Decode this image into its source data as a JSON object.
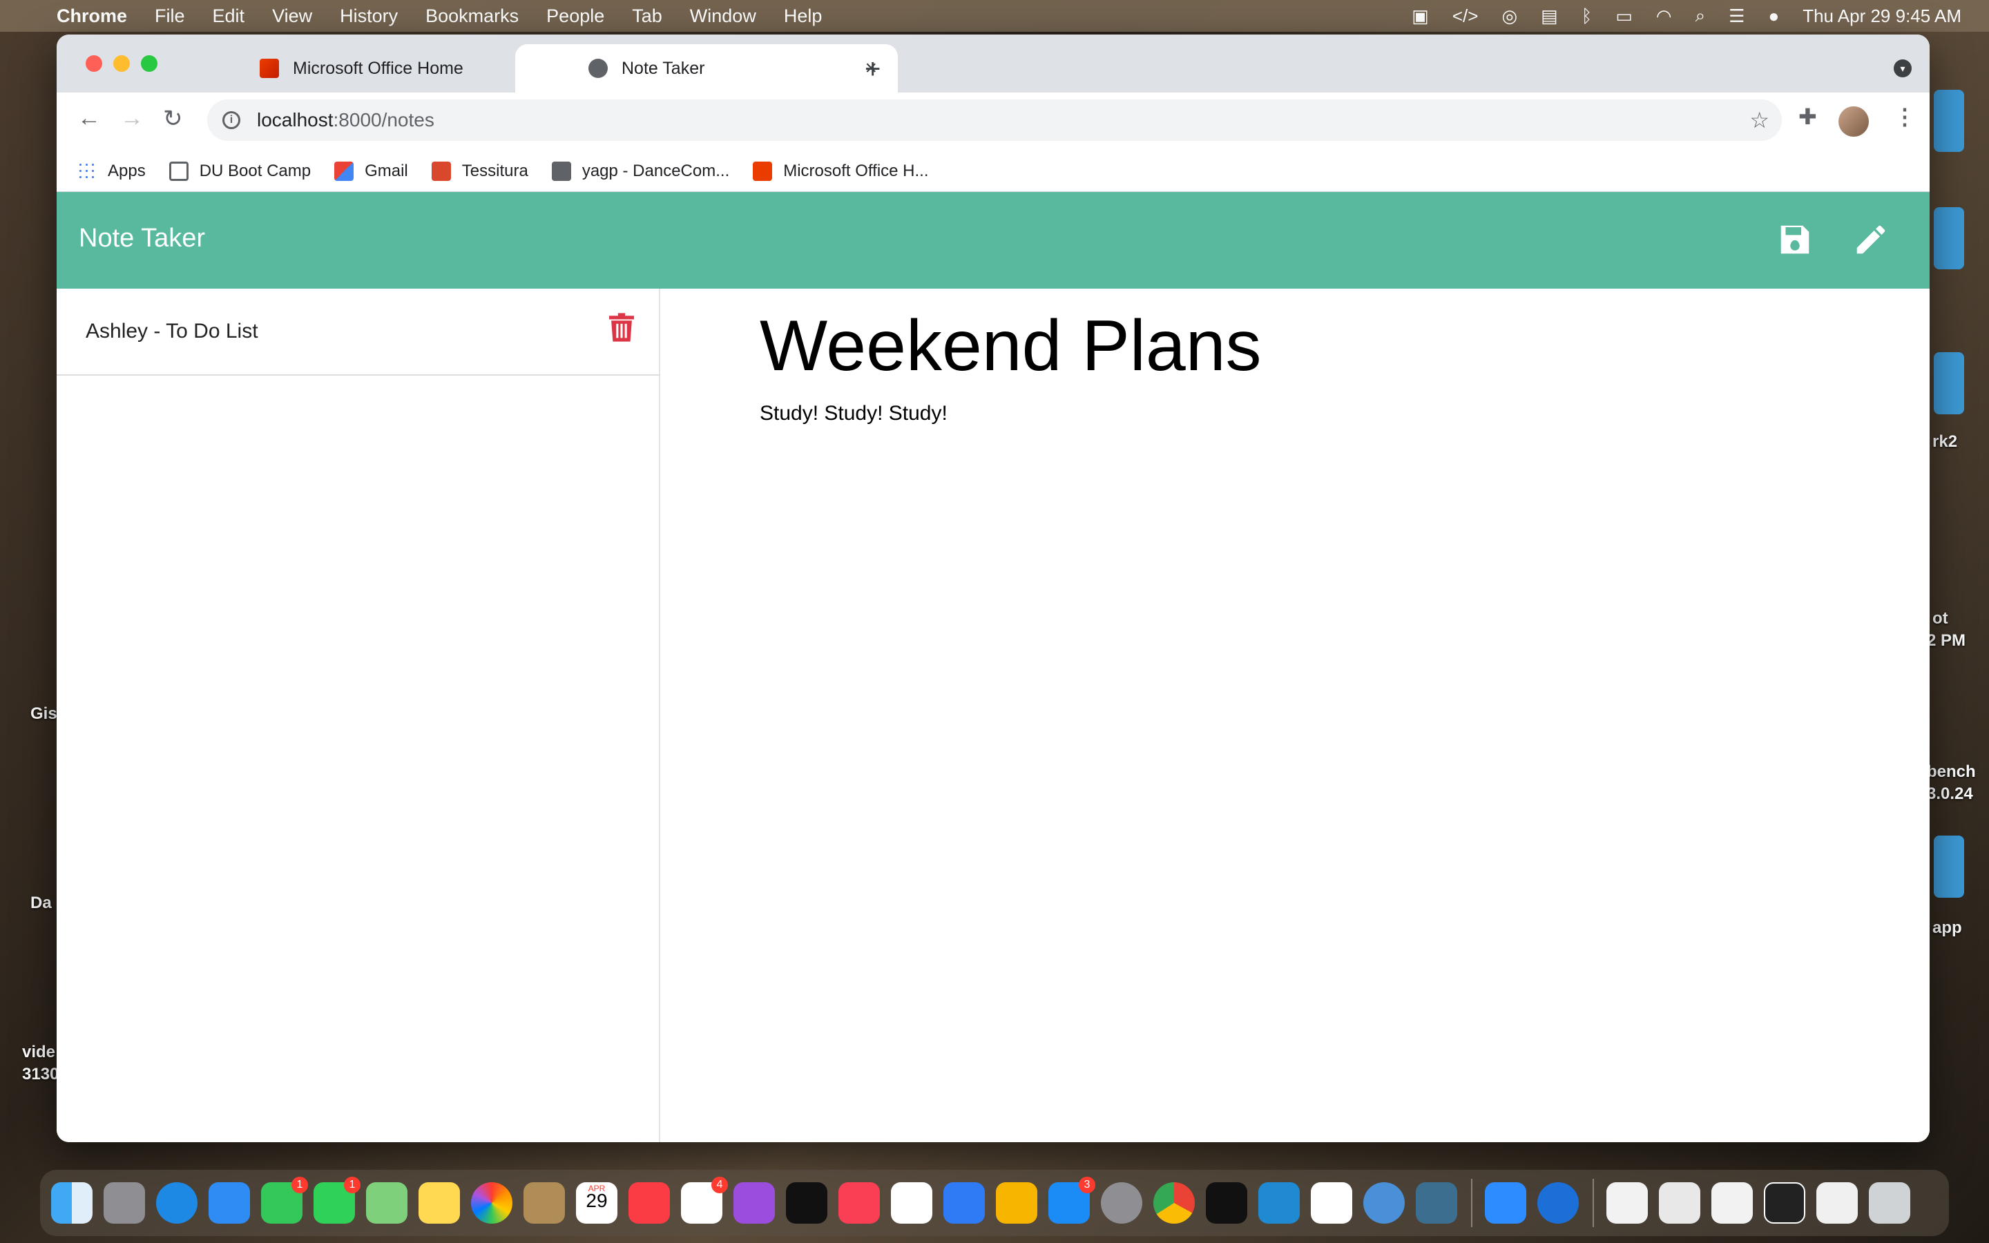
{
  "menubar": {
    "app_name": "Chrome",
    "items": [
      "File",
      "Edit",
      "View",
      "History",
      "Bookmarks",
      "People",
      "Tab",
      "Window",
      "Help"
    ],
    "datetime": "Thu Apr 29  9:45 AM"
  },
  "desktop_labels": {
    "left1": "Gis",
    "left2": "Da",
    "left3": "vide",
    "left3b": "3130",
    "right1": "rk2",
    "right2": "ot",
    "right3": "2 PM",
    "right4": "bench",
    "right5": "3.0.24",
    "right6": "app"
  },
  "browser": {
    "tabs": [
      {
        "title": "Microsoft Office Home",
        "active": false
      },
      {
        "title": "Note Taker",
        "active": true
      }
    ],
    "url_host": "localhost",
    "url_path": ":8000/notes",
    "bookmarks": [
      "Apps",
      "DU Boot Camp",
      "Gmail",
      "Tessitura",
      "yagp - DanceCom...",
      "Microsoft Office H..."
    ]
  },
  "app": {
    "title": "Note Taker",
    "notes": [
      {
        "title": "Ashley - To Do List"
      }
    ],
    "active_note": {
      "title": "Weekend Plans",
      "body": "Study! Study! Study!"
    },
    "colors": {
      "nav": "#58b99e",
      "trash": "#dc3545"
    }
  },
  "dock": {
    "badges": {
      "messages": "1",
      "facetime": "1",
      "calendar_month": "APR",
      "calendar_day": "29",
      "reminders": "4",
      "appstore": "3"
    }
  }
}
